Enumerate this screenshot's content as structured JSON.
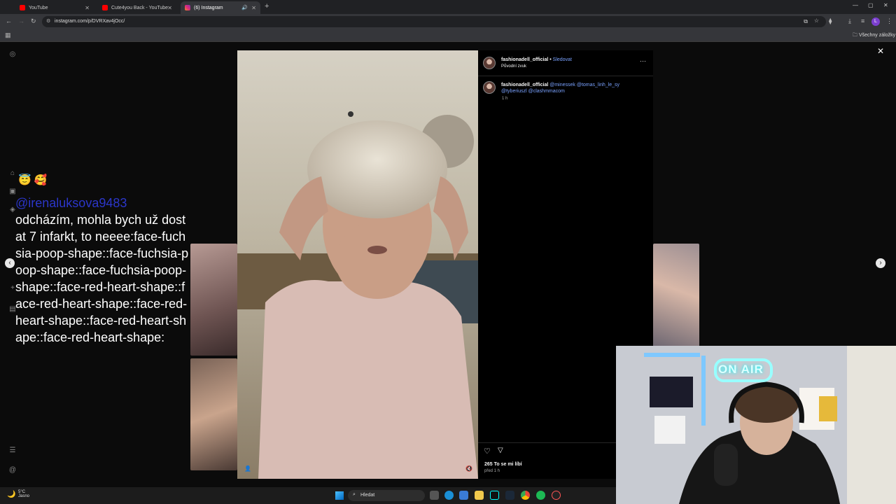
{
  "browser": {
    "tabs": [
      {
        "title": "YouTube",
        "color": "#ff0000"
      },
      {
        "title": "Cute4you Back - YouTube",
        "color": "#ff0000"
      },
      {
        "title": "(6) Instagram",
        "color": "#e1306c"
      }
    ],
    "url": "instagram.com/p/DVRXav4jOcc/",
    "bookmarks_label": "Všechny záložky",
    "profile_initial": "L"
  },
  "chat": {
    "emojis": "😇 🥰",
    "username": "@irenaluksova9483",
    "message": "odcházím, mohla bych už dostat 7 infarkt, to neeee:face-fuchsia-poop-shape::face-fuchsia-poop-shape::face-fuchsia-poop-shape::face-red-heart-shape::face-red-heart-shape::face-red-heart-shape::face-red-heart-shape::face-red-heart-shape:"
  },
  "post": {
    "author": "fashionadell_official",
    "separator": "•",
    "follow_label": "Sledovat",
    "audio": "Původní zvuk",
    "more_icon": "···",
    "caption_author": "fashionadell_official",
    "mentions": "@minessek @tomas_linh_le_sy @tyberiuszl @clashmmacom",
    "caption_time": "1 h",
    "likes": "265 To se mi líbí",
    "posted": "před 1 h"
  },
  "stream_overlay": {
    "neon": "ON AIR"
  },
  "taskbar": {
    "weather_temp": "5°C",
    "weather_desc": "Jasno",
    "search_placeholder": "Hledat"
  }
}
